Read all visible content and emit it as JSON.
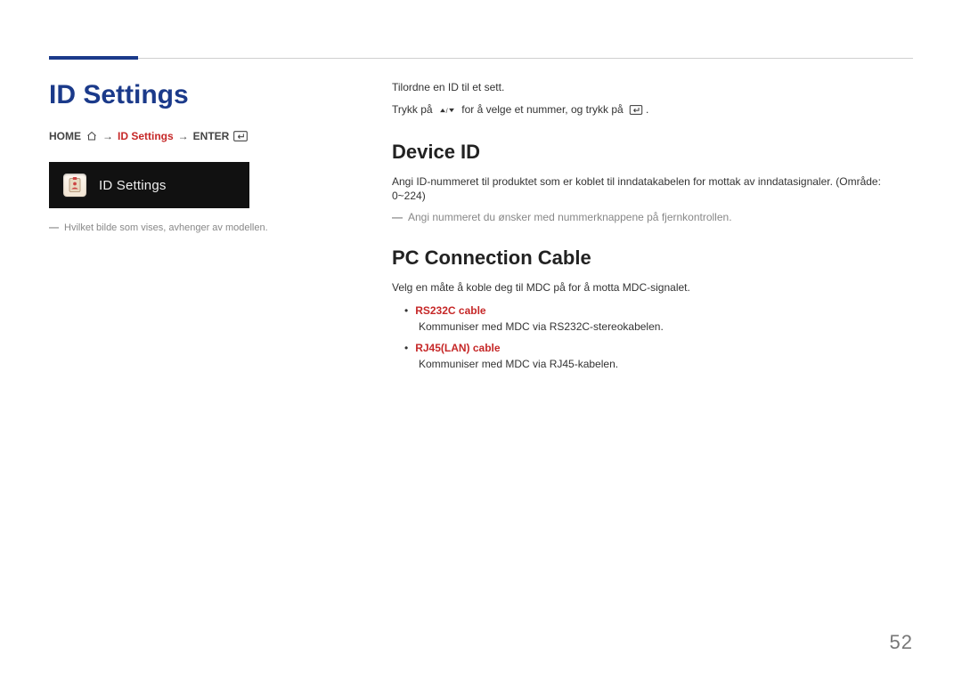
{
  "page": {
    "title": "ID Settings",
    "number": "52"
  },
  "left": {
    "breadcrumb": {
      "home": "HOME",
      "arrow": "→",
      "current": "ID Settings",
      "enter": "ENTER"
    },
    "tile": {
      "label": "ID Settings"
    },
    "note": "Hvilket bilde som vises, avhenger av modellen."
  },
  "right": {
    "intro1": "Tilordne en ID til et sett.",
    "intro2a": "Trykk på",
    "intro2b": "for å velge et nummer, og trykk på",
    "intro2c": ".",
    "device_id": {
      "heading": "Device ID",
      "p1": "Angi ID-nummeret til produktet som er koblet til inndatakabelen for mottak av inndatasignaler. (Område: 0~224)",
      "note": "Angi nummeret du ønsker med nummerknappene på fjernkontrollen."
    },
    "pc_cable": {
      "heading": "PC Connection Cable",
      "p1": "Velg en måte å koble deg til MDC på for å motta MDC-signalet.",
      "items": [
        {
          "label": "RS232C cable",
          "desc": "Kommuniser med MDC via RS232C-stereokabelen."
        },
        {
          "label": "RJ45(LAN) cable",
          "desc": "Kommuniser med MDC via RJ45-kabelen."
        }
      ]
    }
  }
}
